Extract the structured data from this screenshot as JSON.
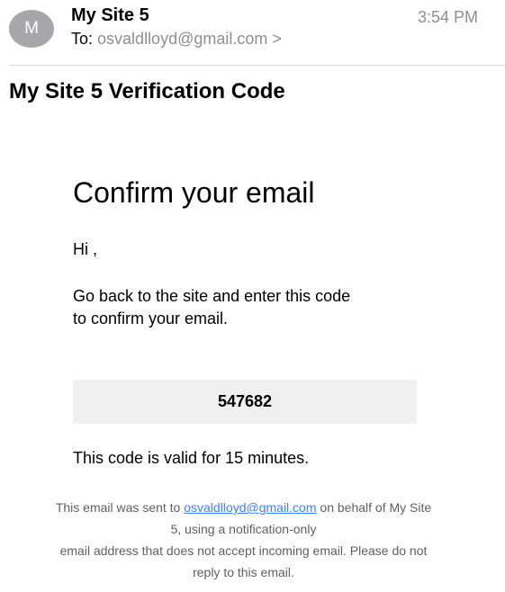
{
  "header": {
    "avatar_letter": "M",
    "sender": "My Site 5",
    "time": "3:54 PM",
    "to_label": "To:",
    "recipient": "osvaldlloyd@gmail.com",
    "recipient_chevron": ">"
  },
  "subject": "My Site 5 Verification Code",
  "body": {
    "title": "Confirm your email",
    "greeting": "Hi ,",
    "instructions_line1": "Go back to the site and enter this code",
    "instructions_line2": "to confirm your email.",
    "code": "547682",
    "validity": "This code is valid for 15 minutes."
  },
  "footer": {
    "text_before_link": "This email was sent to",
    "link": "osvaldlloyd@gmail.com",
    "line1_rest": "on behalf of My Site",
    "line2": "5, using a notification-only",
    "line3": "email address that does not accept incoming email. Please do not",
    "line4": "reply to this email."
  },
  "colors": {
    "avatar": "#a7a7ab",
    "secondary_text": "#8e8e93",
    "code_background": "#f0f0f0",
    "link": "#3b82f6"
  }
}
